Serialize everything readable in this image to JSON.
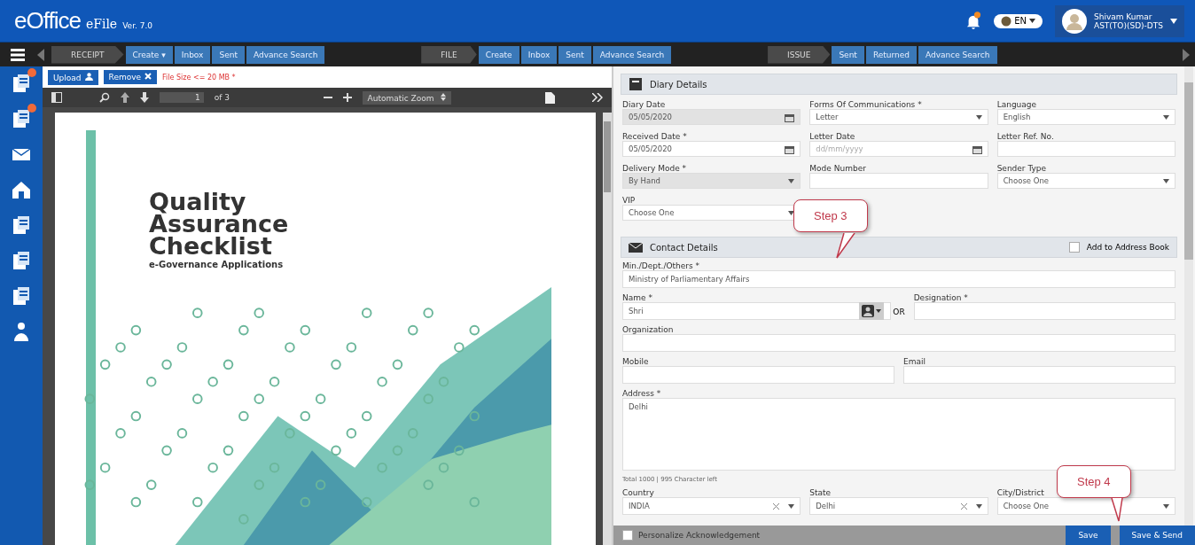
{
  "header": {
    "logo": "eOffice",
    "app": "eFile",
    "version": "Ver. 7.0",
    "language": "EN",
    "user": {
      "name": "Shivam Kumar",
      "designation": "AST(TO)(SD)-DTS"
    }
  },
  "nav": [
    {
      "group": "RECEIPT",
      "items": [
        "Create ▾",
        "Inbox",
        "Sent",
        "Advance Search"
      ]
    },
    {
      "group": "FILE",
      "items": [
        "Create",
        "Inbox",
        "Sent",
        "Advance Search"
      ]
    },
    {
      "group": "ISSUE",
      "items": [
        "Sent",
        "Returned",
        "Advance Search"
      ]
    }
  ],
  "sidebar": {
    "items": [
      {
        "badge": true
      },
      {
        "badge": true
      },
      {
        "badge": false
      },
      {
        "badge": false
      },
      {
        "badge": false
      },
      {
        "badge": false
      },
      {
        "badge": false
      },
      {
        "badge": false
      }
    ]
  },
  "upload_bar": {
    "upload": "Upload",
    "remove": "Remove",
    "hint": "File Size <= 20 MB *"
  },
  "pdf_viewer": {
    "page": "1",
    "page_count": "of 3",
    "zoom": "Automatic Zoom",
    "document": {
      "title_lines": [
        "Quality",
        "Assurance",
        "Checklist"
      ],
      "subtitle": "e-Governance Applications"
    }
  },
  "diary": {
    "title": "Diary Details",
    "fields": [
      {
        "label": "Diary Date",
        "value": "05/05/2020",
        "kind": "date",
        "disabled": true
      },
      {
        "label": "Forms Of Communications *",
        "value": "Letter",
        "kind": "select",
        "disabled": false
      },
      {
        "label": "Language",
        "value": "English",
        "kind": "select",
        "disabled": false
      },
      {
        "label": "Received Date *",
        "value": "05/05/2020",
        "kind": "date",
        "disabled": false
      },
      {
        "label": "Letter Date",
        "placeholder": "dd/mm/yyyy",
        "kind": "date",
        "disabled": false
      },
      {
        "label": "Letter Ref. No.",
        "kind": "text",
        "disabled": false
      },
      {
        "label": "Delivery Mode *",
        "value": "By Hand",
        "kind": "select",
        "disabled": true
      },
      {
        "label": "Mode Number",
        "kind": "text",
        "disabled": false
      },
      {
        "label": "Sender Type",
        "value": "Choose One",
        "kind": "select",
        "disabled": false
      },
      {
        "label": "VIP",
        "value": "Choose One",
        "kind": "select",
        "disabled": false
      }
    ]
  },
  "contact": {
    "title": "Contact Details",
    "address_book": {
      "label": "Add to Address Book",
      "checked": false
    },
    "rows": [
      {
        "fields": [
          {
            "label": "Min./Dept./Others *",
            "value": "Ministry of Parliamentary Affairs",
            "kind": "text"
          }
        ]
      },
      {
        "separator": "OR",
        "fields": [
          {
            "label": "Name *",
            "value": "Shri",
            "kind": "person"
          },
          {
            "label": "Designation *",
            "kind": "text"
          }
        ]
      },
      {
        "fields": [
          {
            "label": "Organization",
            "kind": "text"
          }
        ]
      },
      {
        "fields": [
          {
            "label": "Mobile",
            "kind": "text"
          },
          {
            "label": "Email",
            "kind": "text"
          }
        ]
      },
      {
        "fields": [
          {
            "label": "Address *",
            "value": "Delhi",
            "kind": "textarea"
          }
        ]
      },
      {
        "note": "Total 1000 | 995 Character left"
      },
      {
        "fields": [
          {
            "label": "Country",
            "value": "INDIA",
            "kind": "clearable"
          },
          {
            "label": "State",
            "value": "Delhi",
            "kind": "clearable"
          },
          {
            "label": "City/District",
            "value": "Choose One",
            "kind": "select"
          }
        ]
      }
    ]
  },
  "footer": {
    "acknowledgement": {
      "label": "Personalize Acknowledgement",
      "checked": false
    },
    "buttons": [
      "Save",
      "Save & Send"
    ]
  },
  "callouts": [
    "Step 3",
    "Step 4"
  ]
}
